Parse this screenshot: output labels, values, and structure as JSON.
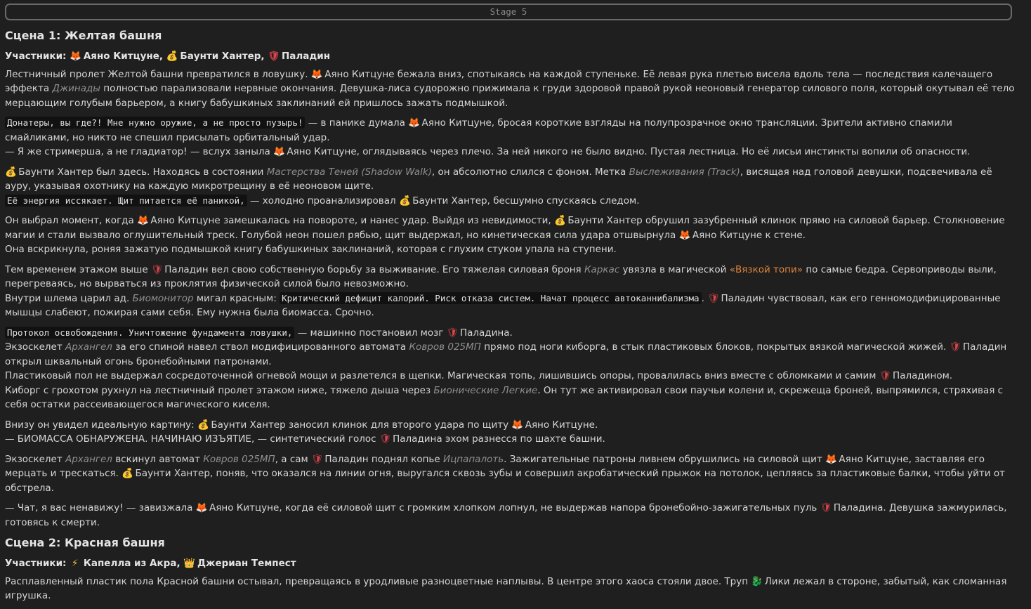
{
  "stage_label": "Stage 5",
  "names": {
    "ayano": "Аяно Китцуне",
    "bounty": "Баунти Хантер",
    "paladin": "Паладин"
  },
  "icons": {
    "ayano": "fox-icon",
    "bounty": "money-bag-icon",
    "paladin": "shield-icon",
    "capella": "lightning-icon",
    "jerian": "crown-icon",
    "liki": "dragon-icon"
  },
  "scene1": {
    "title": "Сцена 1: Желтая башня",
    "participants_label": "Участники:",
    "p1a": "Лестничный пролет Желтой башни превратился в ловушку.",
    "p1b": "бежала вниз, спотыкаясь на каждой ступеньке. Её левая рука плетью висела вдоль тела — последствия калечащего эффекта",
    "p1_term": "Джинады",
    "p1c": "полностью парализовали нервные окончания. Девушка-лиса судорожно прижимала к груди здоровой правой рукой неоновый генератор силового поля, который окутывал её тело мерцающим голубым барьером, а книгу бабушкиных заклинаний ей пришлось зажать подмышкой.",
    "p2_code": "Донатеры, вы где?! Мне нужно оружие, а не просто пузырь!",
    "p2a": "— в панике думала",
    "p2b": ", бросая короткие взгляды на полупрозрачное окно трансляции. Зрители активно спамили смайликами, но никто не спешил присылать орбитальный удар.",
    "p2c": "— Я же стримерша, а не гладиатор! — вслух заныла",
    "p2d": ", оглядываясь через плечо. За ней никого не было видно. Пустая лестница. Но её лисьи инстинкты вопили об опасности.",
    "p3a": "был здесь. Находясь в состоянии",
    "p3_term1": "Мастерства Теней (Shadow Walk)",
    "p3b": ", он абсолютно слился с фоном. Метка",
    "p3_term2": "Выслеживания (Track)",
    "p3c": ", висящая над головой девушки, подсвечивала её ауру, указывая охотнику на каждую микротрещину в её неоновом щите.",
    "p3_code": "Её энергия иссякает. Щит питается её паникой,",
    "p3d": "— холодно проанализировал",
    "p3e": ", бесшумно спускаясь следом.",
    "p4a": "Он выбрал момент, когда",
    "p4b": "замешкалась на повороте, и нанес удар. Выйдя из невидимости,",
    "p4c": "обрушил зазубренный клинок прямо на силовой барьер. Столкновение магии и стали вызвало оглушительный треск. Голубой неон пошел рябью, щит выдержал, но кинетическая сила удара отшвырнула",
    "p4d": "к стене.",
    "p4e": "Она вскрикнула, роняя зажатую подмышкой книгу бабушкиных заклинаний, которая с глухим стуком упала на ступени.",
    "p5a": "Тем временем этажом выше",
    "p5b": "вел свою собственную борьбу за выживание. Его тяжелая силовая броня",
    "p5_term1": "Каркас",
    "p5c": "увязла в магической",
    "p5_accent": "«Вязкой топи»",
    "p5d": "по самые бедра. Сервоприводы выли, перегреваясь, но вырваться из проклятия физической силой было невозможно.",
    "p5e": "Внутри шлема царил ад.",
    "p5_term2": "Биомонитор",
    "p5f": "мигал красным:",
    "p5_code": "Критический дефицит калорий. Риск отказа систем. Начат процесс автоканнибализма",
    "p5g": ".",
    "p5h": "чувствовал, как его генномодифицированные мышцы слабеют, пожирая сами себя. Ему нужна была биомасса. Срочно.",
    "p6_code": "Протокол освобождения. Уничтожение фундамента ловушки,",
    "p6a": "— машинно постановил мозг",
    "p6b": "а.",
    "p6c": "Экзоскелет",
    "p6_term1": "Архангел",
    "p6d": "за его спиной навел ствол модифицированного автомата",
    "p6_term2": "Ковров 025МП",
    "p6e": "прямо под ноги киборга, в стык пластиковых блоков, покрытых вязкой магической жижей.",
    "p6f": "открыл шквальный огонь бронебойными патронами.",
    "p6g": "Пластиковый пол не выдержал сосредоточенной огневой мощи и разлетелся в щепки. Магическая топь, лишившись опоры, провалилась вниз вместе с обломками и самим",
    "p6h": "ом.",
    "p6i": "Киборг с грохотом рухнул на лестничный пролет этажом ниже, тяжело дыша через",
    "p6_term3": "Бионические Легкие",
    "p6j": ". Он тут же активировал свои паучьи колени и, скрежеща броней, выпрямился, стряхивая с себя остатки рассеивающегося магического киселя.",
    "p7a": "Внизу он увидел идеальную картину:",
    "p7b": "заносил клинок для второго удара по щиту",
    "p7c": ".",
    "p7d": "— БИОМАССА ОБНАРУЖЕНА. НАЧИНАЮ ИЗЪЯТИЕ, — синтетический голос",
    "p7e": "а эхом разнесся по шахте башни.",
    "p8a": "Экзоскелет",
    "p8_term1": "Архангел",
    "p8b": "вскинул автомат",
    "p8_term2": "Ковров 025МП",
    "p8c": ", а сам",
    "p8d": "поднял копье",
    "p8_term3": "Ицпапалоть",
    "p8e": ". Зажигательные патроны ливнем обрушились на силовой щит",
    "p8f": ", заставляя его мерцать и трескаться.",
    "p8g": ", поняв, что оказался на линии огня, выругался сквозь зубы и совершил акробатический прыжок на потолок, цепляясь за пластиковые балки, чтобы уйти от обстрела.",
    "p9a": "— Чат, я вас ненавижу! — завизжала",
    "p9b": ", когда её силовой щит с громким хлопком лопнул, не выдержав напора бронебойно-зажигательных пуль",
    "p9c": "а. Девушка зажмурилась, готовясь к смерти."
  },
  "scene2": {
    "title": "Сцена 2: Красная башня",
    "participants_label": "Участники:",
    "capella": "Капелла из Акра",
    "jerian": "Джериан Темпест",
    "p1a": "Расплавленный пластик пола Красной башни остывал, превращаясь в уродливые разноцветные наплывы. В центре этого хаоса стояли двое. Труп",
    "p1_liki": "Лики",
    "p1b": "лежал в стороне, забытый, как сломанная игрушка."
  }
}
